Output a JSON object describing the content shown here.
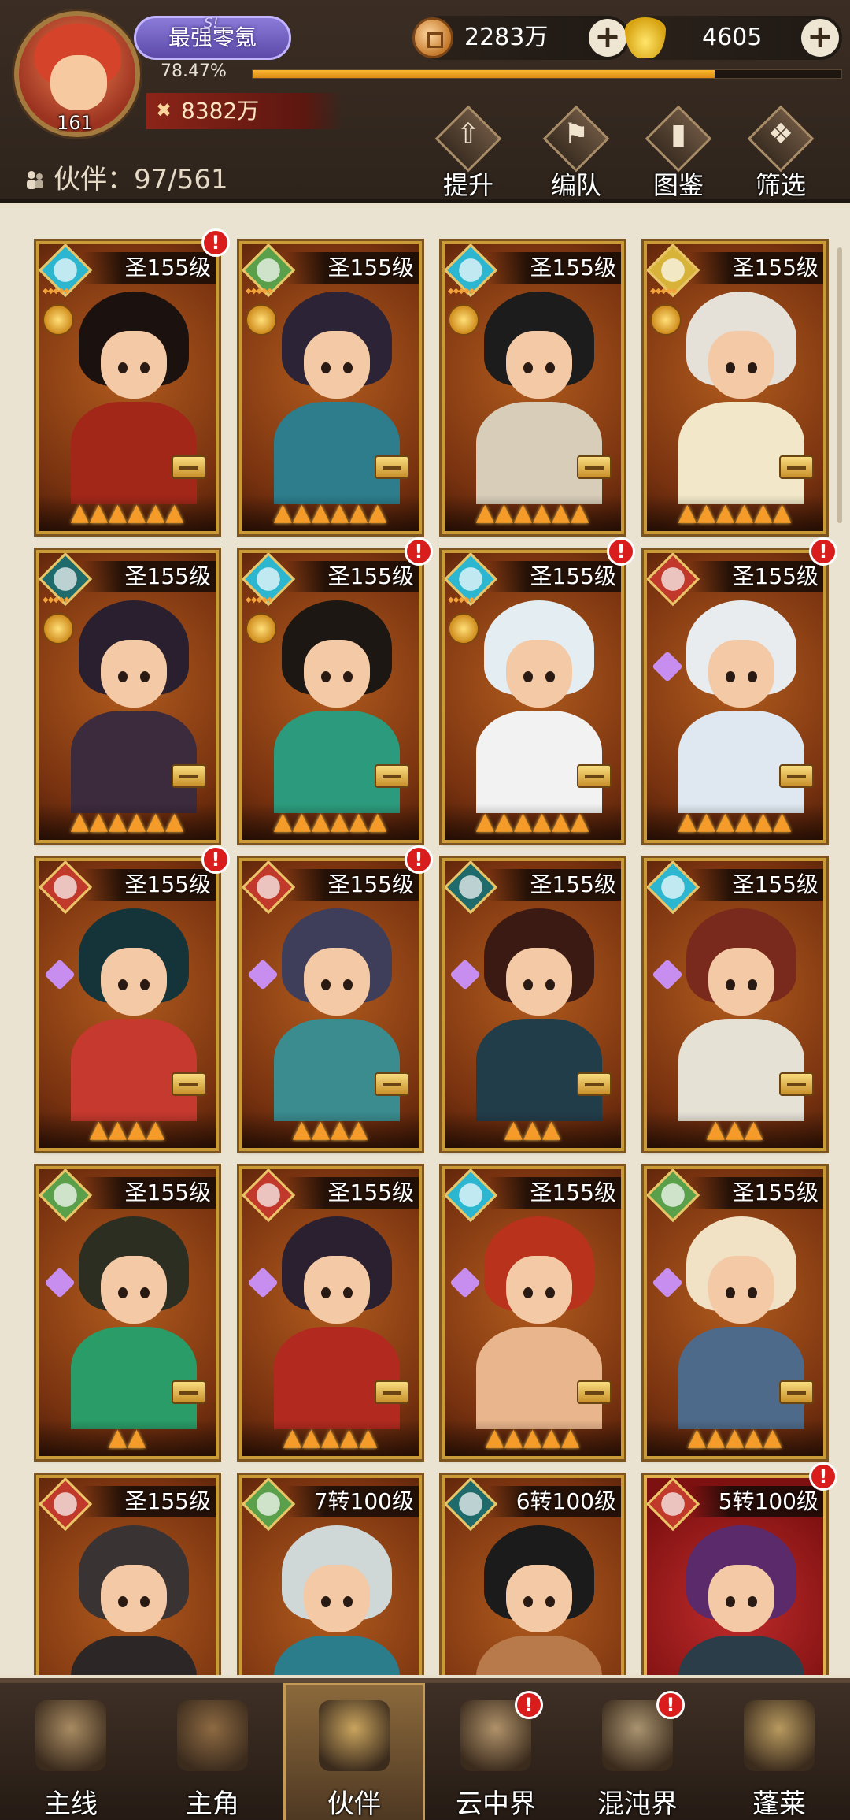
{
  "player": {
    "name": "最强零氪",
    "server_tag": "S!",
    "level": "161",
    "exp_percent": "78.47%",
    "exp_fill": 0.7847,
    "power": "8382万"
  },
  "currencies": [
    {
      "icon": "copper-coin-icon",
      "value": "2283万"
    },
    {
      "icon": "gold-ingot-icon",
      "value": "4605"
    }
  ],
  "partner_count": {
    "label": "伙伴：",
    "value": "97/561"
  },
  "actions": [
    {
      "name": "upgrade",
      "label": "提升",
      "glyph": "⇧"
    },
    {
      "name": "formation",
      "label": "编队",
      "glyph": "⚑"
    },
    {
      "name": "codex",
      "label": "图鉴",
      "glyph": "▮"
    },
    {
      "name": "filter",
      "label": "筛选",
      "glyph": "❖"
    }
  ],
  "heroes": [
    {
      "level": "圣155级",
      "element": "water",
      "flames": 6,
      "alert": true,
      "medal": true,
      "colors": [
        "#1b1210",
        "#a32719"
      ]
    },
    {
      "level": "圣155级",
      "element": "wood",
      "flames": 6,
      "alert": false,
      "medal": true,
      "colors": [
        "#2c2436",
        "#2d7d8c"
      ]
    },
    {
      "level": "圣155级",
      "element": "water",
      "flames": 6,
      "alert": false,
      "medal": true,
      "colors": [
        "#1c1c1c",
        "#d8cdb9"
      ]
    },
    {
      "level": "圣155级",
      "element": "gold",
      "flames": 6,
      "alert": false,
      "medal": true,
      "colors": [
        "#e6e1d8",
        "#f2e7c8"
      ]
    },
    {
      "level": "圣155级",
      "element": "dark",
      "flames": 6,
      "alert": false,
      "medal": true,
      "colors": [
        "#2a1f2f",
        "#3c2a3d"
      ]
    },
    {
      "level": "圣155级",
      "element": "water",
      "flames": 6,
      "alert": true,
      "medal": true,
      "colors": [
        "#1d1714",
        "#2c9a7c"
      ]
    },
    {
      "level": "圣155级",
      "element": "water",
      "flames": 6,
      "alert": true,
      "medal": true,
      "colors": [
        "#e3edf2",
        "#f2f2f2"
      ]
    },
    {
      "level": "圣155级",
      "element": "fire",
      "flames": 6,
      "alert": true,
      "medal": false,
      "colors": [
        "#e9ecef",
        "#dfe8f0"
      ]
    },
    {
      "level": "圣155级",
      "element": "fire",
      "flames": 4,
      "alert": true,
      "medal": false,
      "colors": [
        "#14343a",
        "#c6392f"
      ]
    },
    {
      "level": "圣155级",
      "element": "fire",
      "flames": 4,
      "alert": true,
      "medal": false,
      "colors": [
        "#3e3e5a",
        "#3a8c8f"
      ]
    },
    {
      "level": "圣155级",
      "element": "dark",
      "flames": 3,
      "alert": false,
      "medal": false,
      "colors": [
        "#3c1a14",
        "#223d4a"
      ]
    },
    {
      "level": "圣155级",
      "element": "water",
      "flames": 3,
      "alert": false,
      "medal": false,
      "colors": [
        "#7a2a1c",
        "#e5e1d5"
      ]
    },
    {
      "level": "圣155级",
      "element": "wood",
      "flames": 2,
      "alert": false,
      "medal": false,
      "colors": [
        "#2c2e22",
        "#2a9c68"
      ]
    },
    {
      "level": "圣155级",
      "element": "fire",
      "flames": 5,
      "alert": false,
      "medal": false,
      "colors": [
        "#2a2030",
        "#b22a1f"
      ]
    },
    {
      "level": "圣155级",
      "element": "water",
      "flames": 5,
      "alert": false,
      "medal": false,
      "colors": [
        "#b8321c",
        "#e9b58c"
      ]
    },
    {
      "level": "圣155级",
      "element": "wood",
      "flames": 5,
      "alert": false,
      "medal": false,
      "colors": [
        "#f1e2c5",
        "#4e6a8a"
      ]
    },
    {
      "level": "圣155级",
      "element": "fire",
      "flames": 0,
      "alert": false,
      "medal": false,
      "colors": [
        "#3a3333",
        "#2c2626"
      ]
    },
    {
      "level": "7转100级",
      "element": "wood",
      "flames": 0,
      "alert": false,
      "medal": false,
      "colors": [
        "#cfd8d6",
        "#2c7d8c"
      ]
    },
    {
      "level": "6转100级",
      "element": "dark",
      "flames": 0,
      "alert": false,
      "medal": false,
      "colors": [
        "#1b1b1b",
        "#b87a4a"
      ]
    },
    {
      "level": "5转100级",
      "element": "fire",
      "flames": 0,
      "alert": true,
      "medal": false,
      "colors": [
        "#5a2a6a",
        "#2c3d4a"
      ]
    }
  ],
  "nav": [
    {
      "name": "main-quest",
      "label": "主线",
      "alert": false,
      "active": false
    },
    {
      "name": "hero",
      "label": "主角",
      "alert": false,
      "active": false
    },
    {
      "name": "partners",
      "label": "伙伴",
      "alert": false,
      "active": true
    },
    {
      "name": "cloud-realm",
      "label": "云中界",
      "alert": true,
      "active": false
    },
    {
      "name": "chaos-realm",
      "label": "混沌界",
      "alert": true,
      "active": false
    },
    {
      "name": "penglai",
      "label": "蓬莱",
      "alert": false,
      "active": false
    }
  ],
  "colors": {
    "water": "#2cb6d0",
    "wood": "#5aa04a",
    "gold": "#d8b33a",
    "dark": "#1f6a6a",
    "fire": "#c0392b",
    "flame": "#f59b2a",
    "alert": "#d91c1c"
  }
}
